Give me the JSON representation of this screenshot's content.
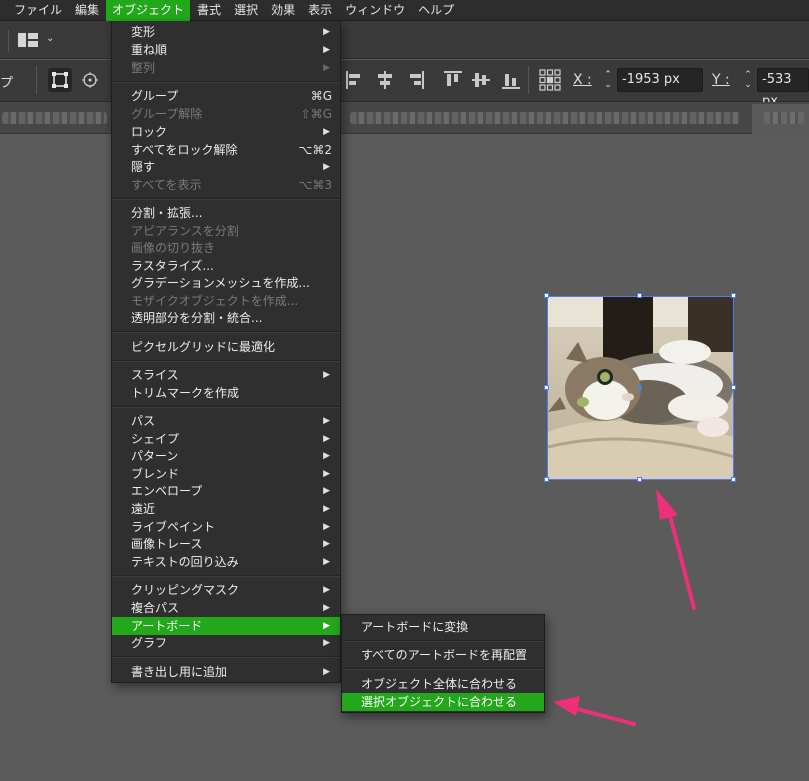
{
  "menubar": {
    "items": [
      "ファイル",
      "編集",
      "オブジェクト",
      "書式",
      "選択",
      "効果",
      "表示",
      "ウィンドウ",
      "ヘルプ"
    ],
    "active_index": 2
  },
  "toolbar": {
    "left_fragment": "プ",
    "x_label": "X :",
    "x_value": "-1953 px",
    "y_label": "Y :",
    "y_value": "-533 px"
  },
  "object_menu": {
    "transform": "変形",
    "arrange": "重ね順",
    "align": "整列",
    "group": "グループ",
    "group_sc": "⌘G",
    "ungroup": "グループ解除",
    "ungroup_sc": "⇧⌘G",
    "lock": "ロック",
    "unlock_all": "すべてをロック解除",
    "unlock_all_sc": "⌥⌘2",
    "hide": "隠す",
    "show_all": "すべてを表示",
    "show_all_sc": "⌥⌘3",
    "expand": "分割・拡張...",
    "expand_appearance": "アピアランスを分割",
    "crop_image": "画像の切り抜き",
    "rasterize": "ラスタライズ...",
    "gradient_mesh": "グラデーションメッシュを作成...",
    "mosaic": "モザイクオブジェクトを作成...",
    "flatten_transparency": "透明部分を分割・統合...",
    "pixel_perfect": "ピクセルグリッドに最適化",
    "slice": "スライス",
    "trim_marks": "トリムマークを作成",
    "path": "パス",
    "shape": "シェイプ",
    "pattern": "パターン",
    "blend": "ブレンド",
    "envelope": "エンベロープ",
    "perspective": "遠近",
    "live_paint": "ライブペイント",
    "image_trace": "画像トレース",
    "text_wrap": "テキストの回り込み",
    "clipping_mask": "クリッピングマスク",
    "compound_path": "複合パス",
    "artboard": "アートボード",
    "graph": "グラフ",
    "export_add": "書き出し用に追加"
  },
  "artboard_submenu": {
    "convert": "アートボードに変換",
    "rearrange_all": "すべてのアートボードを再配置",
    "fit_artwork_bounds": "オブジェクト全体に合わせる",
    "fit_selected": "選択オブジェクトに合わせる"
  },
  "colors": {
    "highlight": "#22a81a",
    "selection": "#4b7bf5",
    "annotation_arrow": "#ee2f7a"
  }
}
